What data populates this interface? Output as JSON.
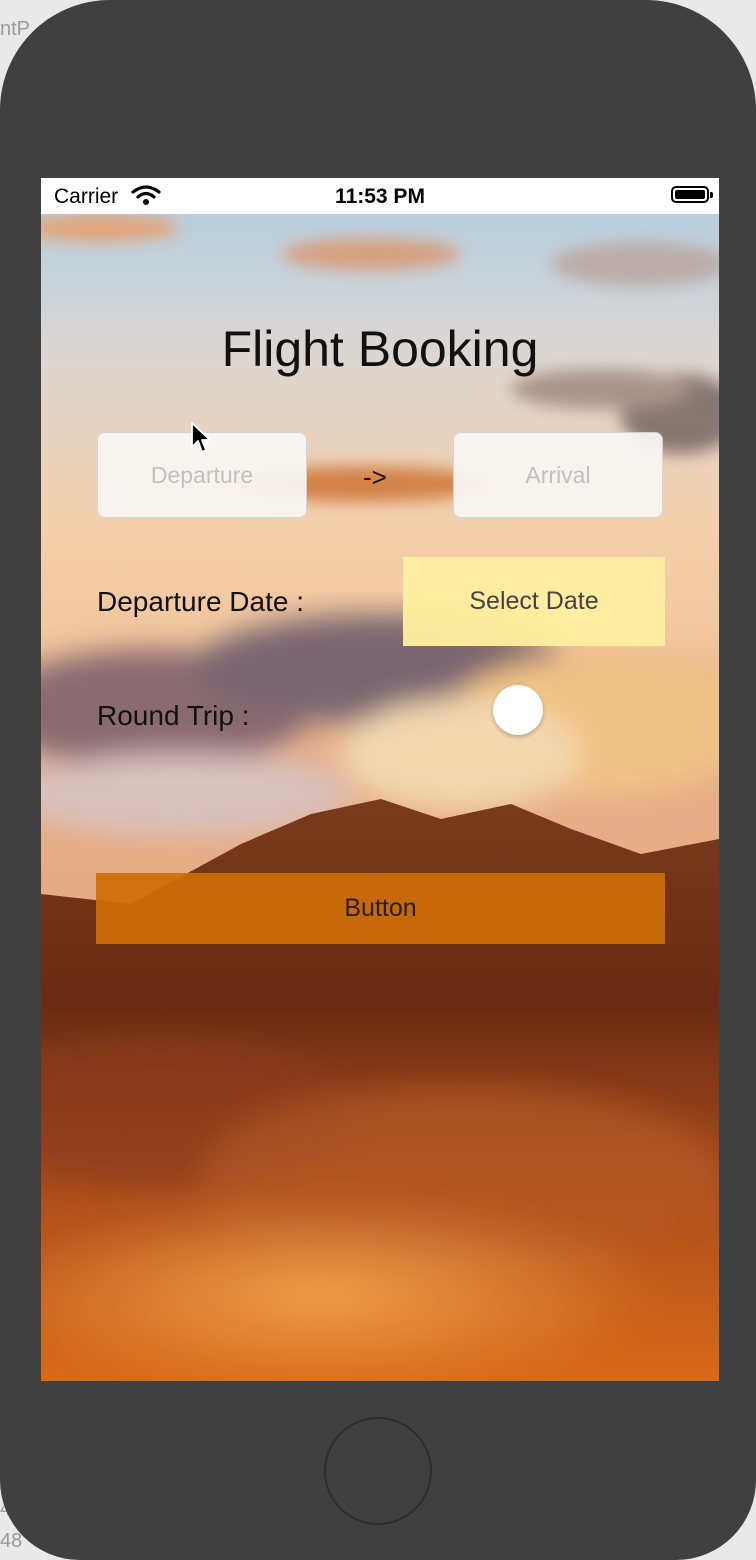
{
  "status_bar": {
    "carrier": "Carrier",
    "time": "11:53 PM"
  },
  "app": {
    "title": "Flight Booking",
    "departure_placeholder": "Departure",
    "arrow": "->",
    "arrival_placeholder": "Arrival",
    "departure_date_label": "Departure Date :",
    "select_date_label": "Select Date",
    "round_trip_label": "Round Trip :",
    "round_trip_on": false,
    "button_label": "Button"
  },
  "background_peek": {
    "top_left": "ntP",
    "bottom_left_1": "4",
    "bottom_left_2": "48"
  },
  "colors": {
    "device": "#404040",
    "date_button": "#fff0a0",
    "main_button": "#cd6e08"
  },
  "icons": [
    "wifi-icon",
    "battery-icon",
    "cursor-icon",
    "home-button"
  ]
}
